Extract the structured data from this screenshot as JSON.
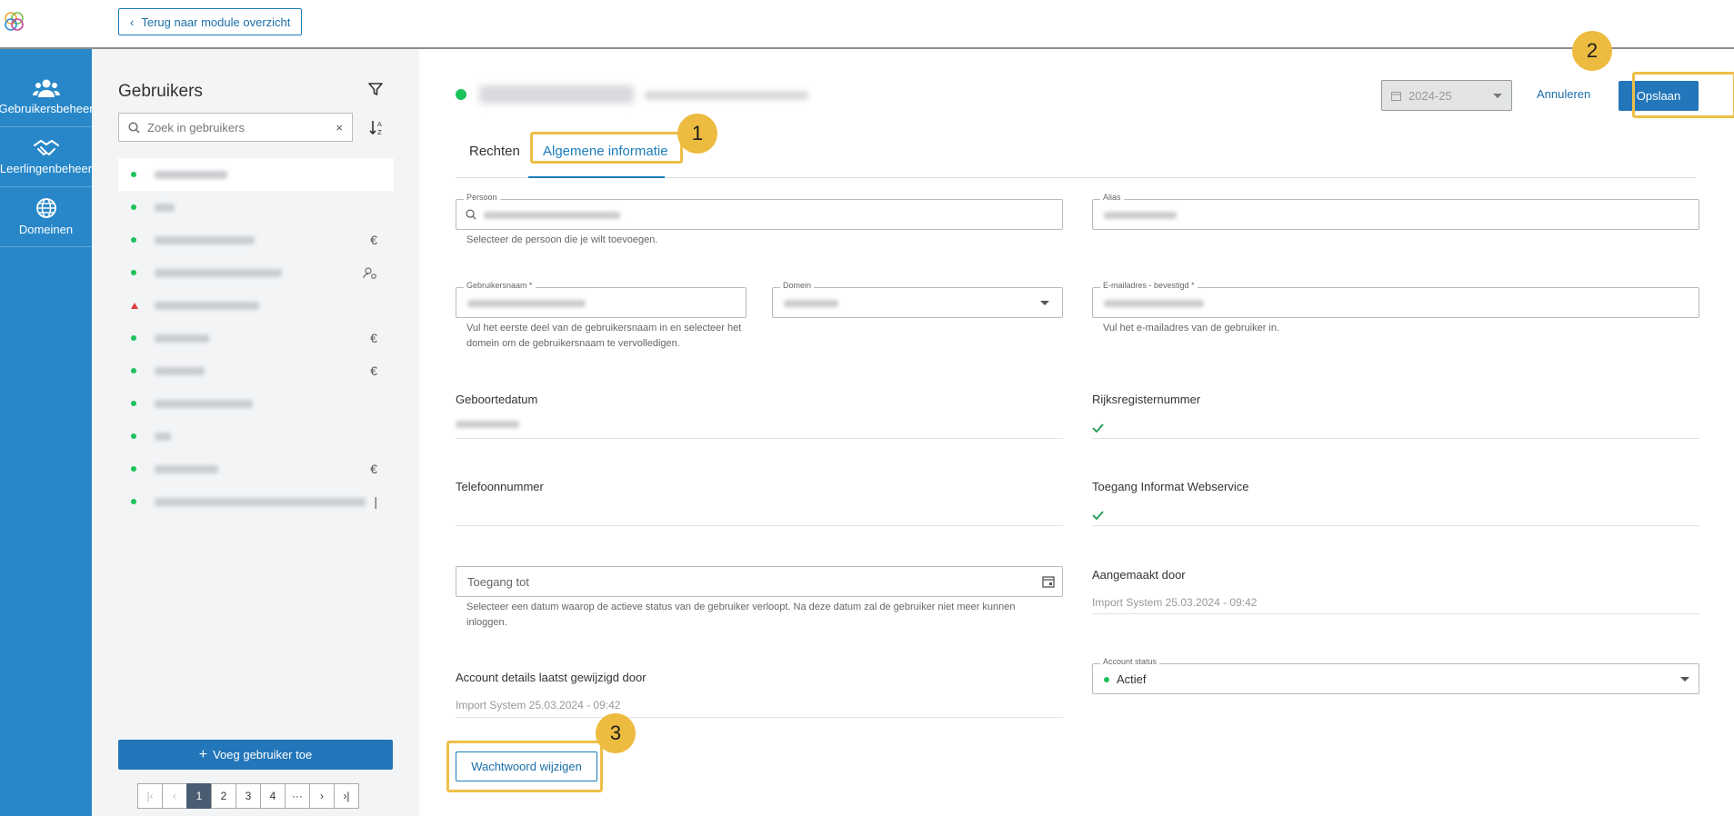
{
  "topbar": {
    "back_label": "Terug naar module overzicht"
  },
  "nav": [
    {
      "label": "Gebruikersbeheer",
      "icon": "users-icon"
    },
    {
      "label": "Leerlingenbeheer",
      "icon": "handshake-icon"
    },
    {
      "label": "Domeinen",
      "icon": "globe-icon"
    }
  ],
  "users": {
    "title": "Gebruikers",
    "search_placeholder": "Zoek in gebruikers",
    "add_label": "Voeg gebruiker toe",
    "rows": [
      {
        "status": "active",
        "badge": ""
      },
      {
        "status": "active",
        "badge": ""
      },
      {
        "status": "active",
        "badge": "€"
      },
      {
        "status": "active",
        "badge": "person-gear"
      },
      {
        "status": "warning",
        "badge": ""
      },
      {
        "status": "active",
        "badge": "€"
      },
      {
        "status": "active",
        "badge": "€"
      },
      {
        "status": "active",
        "badge": ""
      },
      {
        "status": "active",
        "badge": ""
      },
      {
        "status": "active",
        "badge": "€"
      },
      {
        "status": "active",
        "badge": "|"
      }
    ],
    "pagination": {
      "pages": [
        "1",
        "2",
        "3",
        "4",
        "···"
      ],
      "current": "1"
    }
  },
  "header": {
    "school_year": "2024-25",
    "cancel_label": "Annuleren",
    "save_label": "Opslaan"
  },
  "tabs": {
    "rights": "Rechten",
    "general": "Algemene informatie"
  },
  "callouts": {
    "one": "1",
    "two": "2",
    "three": "3"
  },
  "form": {
    "person_label": "Persoon",
    "person_hint": "Selecteer de persoon die je wilt toevoegen.",
    "alias_label": "Alias",
    "username_label": "Gebruikersnaam *",
    "username_hint": "Vul het eerste deel van de gebruikersnaam in en selecteer het domein om de gebruikersnaam te vervolledigen.",
    "domain_label": "Domein",
    "email_label": "E-mailadres - bevestigd *",
    "email_hint": "Vul het e-mailadres van de gebruiker in.",
    "birthdate_label": "Geboortedatum",
    "rrn_label": "Rijksregisternummer",
    "phone_label": "Telefoonnummer",
    "webservice_label": "Toegang Informat Webservice",
    "access_until_placeholder": "Toegang tot",
    "access_until_hint": "Selecteer een datum waarop de actieve status van de gebruiker verloopt. Na deze datum zal de gebruiker niet meer kunnen inloggen.",
    "created_by_label": "Aangemaakt door",
    "created_by_value": "Import System 25.03.2024 - 09:42",
    "modified_by_label": "Account details laatst gewijzigd door",
    "modified_by_value": "Import System 25.03.2024 - 09:42",
    "account_status_label": "Account status",
    "account_status_value": "Actief",
    "change_password_label": "Wachtwoord wijzigen"
  },
  "colors": {
    "nav_blue": "#2787c9",
    "primary": "#2276b9",
    "active_green": "#1cc25b",
    "callout_yellow": "#edbb3f"
  }
}
